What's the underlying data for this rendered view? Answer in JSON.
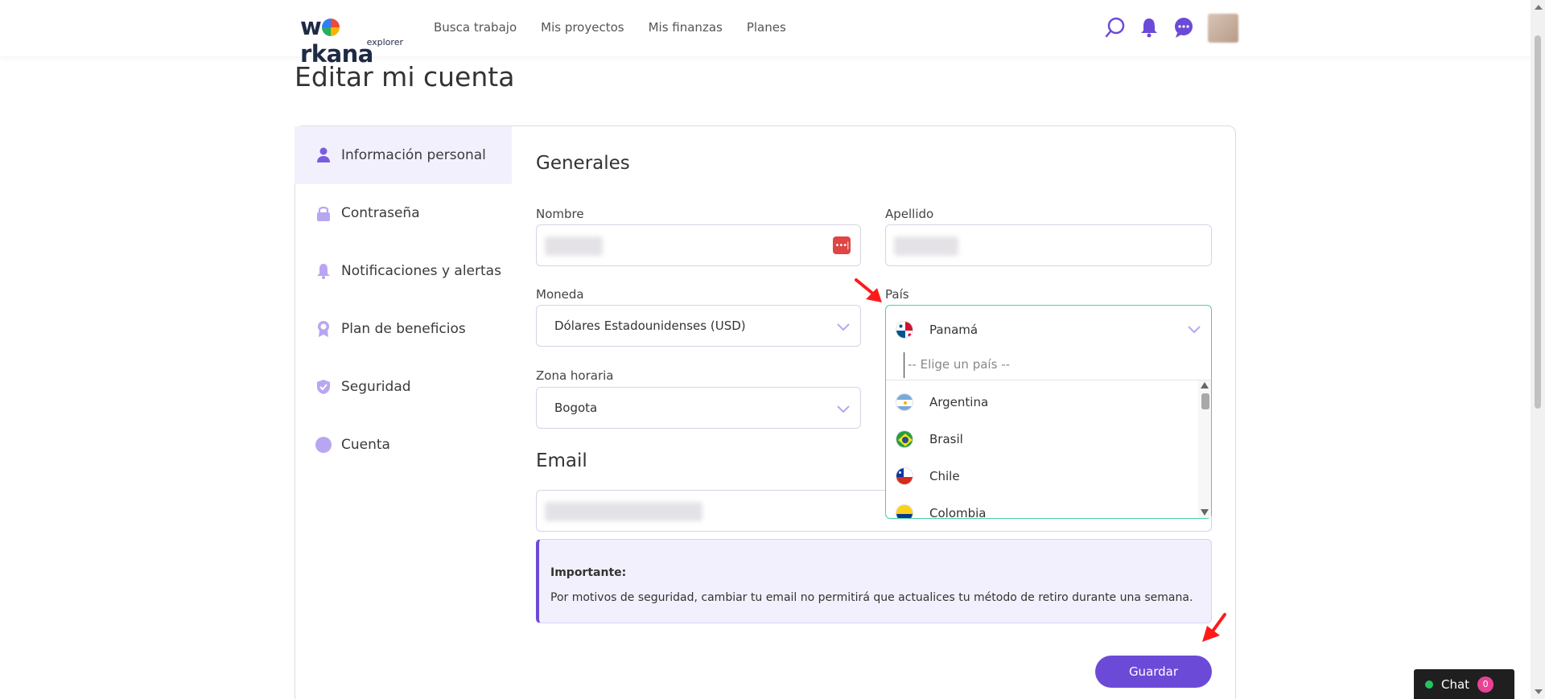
{
  "header": {
    "logo_word_pre": "w",
    "logo_word_post": "rkana",
    "logo_sub": "explorer",
    "nav": [
      "Busca trabajo",
      "Mis proyectos",
      "Mis finanzas",
      "Planes"
    ]
  },
  "page_title": "Editar mi cuenta",
  "sidebar": {
    "items": [
      {
        "label": "Información personal",
        "icon": "user-icon",
        "active": true
      },
      {
        "label": "Contraseña",
        "icon": "lock-icon"
      },
      {
        "label": "Notificaciones y alertas",
        "icon": "bell-icon"
      },
      {
        "label": "Plan de beneficios",
        "icon": "badge-icon"
      },
      {
        "label": "Seguridad",
        "icon": "shield-icon"
      },
      {
        "label": "Cuenta",
        "icon": "circle-icon"
      }
    ]
  },
  "general": {
    "title": "Generales",
    "nombre_label": "Nombre",
    "apellido_label": "Apellido",
    "moneda_label": "Moneda",
    "moneda_value": "Dólares Estadounidenses (USD)",
    "pais_label": "País",
    "zona_label": "Zona horaria",
    "zona_value": "Bogota"
  },
  "country_dropdown": {
    "selected": "Panamá",
    "search_placeholder": "-- Elige un país --",
    "options": [
      "Argentina",
      "Brasil",
      "Chile",
      "Colombia"
    ]
  },
  "email": {
    "title": "Email"
  },
  "notice": {
    "title": "Importante:",
    "text": "Por motivos de seguridad, cambiar tu email no permitirá que actualices tu método de retiro durante una semana."
  },
  "save_label": "Guardar",
  "chat": {
    "label": "Chat",
    "count": "0"
  },
  "colors": {
    "accent": "#6c4ad8",
    "focus": "#4bd0a0",
    "annotation": "#ff1a1a"
  }
}
